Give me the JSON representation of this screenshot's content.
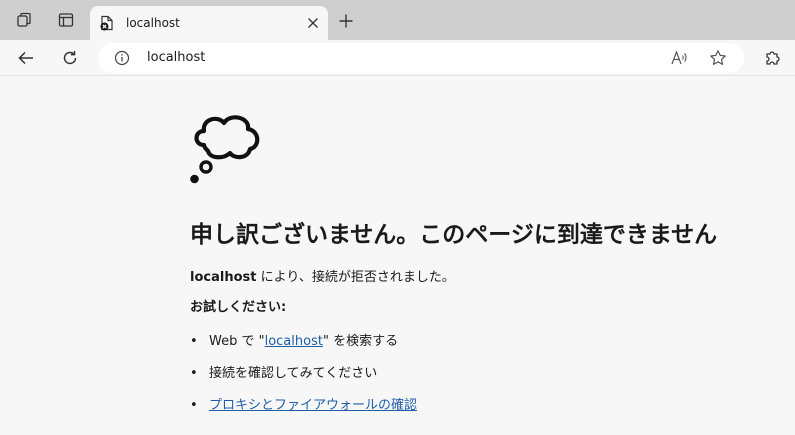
{
  "tab": {
    "title": "localhost",
    "favicon": "error-page-icon"
  },
  "toolbar": {
    "url": "localhost"
  },
  "error": {
    "heading": "申し訳ございません。このページに到達できません",
    "host": "localhost",
    "message_suffix": " により、接続が拒否されました。",
    "try_label": "お試しください:",
    "search_prefix": "Web で \"",
    "search_link": "localhost",
    "search_suffix": "\" を検索する",
    "check_connection": "接続を確認してみてください",
    "check_proxy": "プロキシとファイアウォールの確認"
  },
  "colors": {
    "tabstrip": "#cfcfcf",
    "page_background": "#f7f7f7",
    "link": "#1f5ea8"
  }
}
